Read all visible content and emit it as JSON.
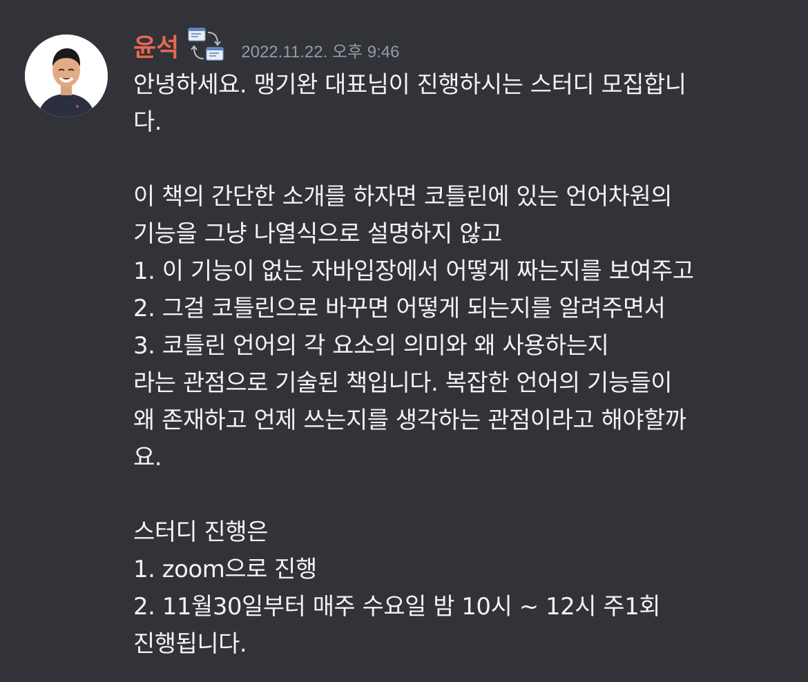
{
  "message": {
    "author": "윤석",
    "timestamp": "2022.11.22. 오후 9:46",
    "author_color": "#e8684f",
    "badge_icon": "server-transfer-icon",
    "avatar_icon": "user-avatar",
    "lines": [
      "안녕하세요. 맹기완 대표님이 진행하시는 스터디 모집합니",
      "다.",
      "",
      "이 책의 간단한 소개를 하자면 코틀린에 있는 언어차원의",
      "기능을 그냥 나열식으로 설명하지 않고",
      "1. 이 기능이 없는 자바입장에서 어떻게 짜는지를 보여주고",
      "2. 그걸 코틀린으로 바꾸면 어떻게 되는지를 알려주면서",
      "3. 코틀린 언어의 각 요소의 의미와 왜 사용하는지",
      "라는 관점으로 기술된 책입니다. 복잡한 언어의 기능들이",
      "왜 존재하고 언제 쓰는지를 생각하는 관점이라고 해야할까",
      "요.",
      "",
      "스터디 진행은",
      "1. zoom으로 진행",
      "2. 11월30일부터 매주 수요일 밤 10시 ~ 12시 주1회",
      "진행됩니다."
    ]
  },
  "theme": {
    "background": "#313338",
    "text": "#f2f3f5",
    "muted": "#949ba4"
  }
}
